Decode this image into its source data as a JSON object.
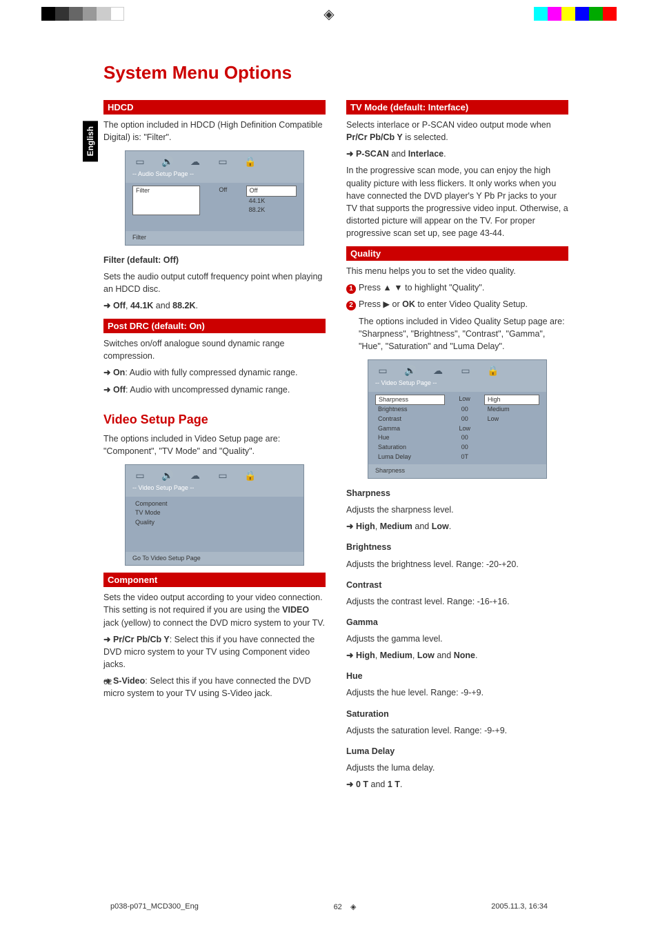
{
  "side_tab": "English",
  "title": "System Menu Options",
  "left": {
    "hdcd": {
      "header": "HDCD",
      "intro": "The option included in HDCD (High Definition Compatible Digital) is: \"Filter\".",
      "ui_crumb": "-- Audio Setup Page --",
      "filter_row": {
        "label": "Filter",
        "value": "Off"
      },
      "options": [
        "Off",
        "44.1K",
        "88.2K"
      ],
      "footer": "Filter",
      "filter_heading": "Filter (default: Off)",
      "filter_body": "Sets the audio output cutoff frequency point when playing an HDCD disc.",
      "filter_opts_prefix": "➜ ",
      "filter_opts": "Off, 44.1K and 88.2K."
    },
    "postdrc": {
      "header": "Post DRC (default: On)",
      "intro": "Switches on/off analogue sound dynamic range compression.",
      "on": "➜ On: Audio with fully compressed dynamic range.",
      "off": "➜ Off: Audio with uncompressed dynamic range."
    },
    "video": {
      "heading": "Video Setup Page",
      "intro": "The options included in Video Setup page are: \"Component\", \"TV Mode\" and \"Quality\".",
      "ui_crumb": "-- Video Setup Page --",
      "items": [
        "Component",
        "TV Mode",
        "Quality"
      ],
      "ui_footer": "Go To Video Setup Page"
    },
    "component": {
      "header": "Component",
      "body1": "Sets the video output according to your video connection. This setting is not required if you are using the VIDEO jack (yellow) to connect the DVD micro system to your TV.",
      "opt1": "➜ Pr/Cr Pb/Cb Y: Select this if you have connected the DVD micro system to your TV using Component video jacks.",
      "opt2": "➜ S-Video: Select this if you have connected the DVD micro system to your TV using S-Video jack."
    }
  },
  "right": {
    "tvmode": {
      "header": "TV Mode (default: Interface)",
      "intro": "Selects interlace or P-SCAN video output mode when Pr/Cr Pb/Cb Y is selected.",
      "opts": "➜ P-SCAN and Interlace.",
      "body": "In the progressive scan mode, you can enjoy the high quality picture with less flickers. It only works when you have connected the DVD player's Y Pb Pr jacks to your TV that supports the progressive video input. Otherwise, a distorted picture will appear on the TV. For proper progressive scan set up, see page 43-44."
    },
    "quality": {
      "header": "Quality",
      "intro": "This menu helps you to set the video quality.",
      "step1": "Press ▲ ▼ to highlight \"Quality\".",
      "step2": "Press ▶ or OK to enter Video Quality Setup.",
      "body": "The options included in Video Quality Setup page are: \"Sharpness\", \"Brightness\", \"Contrast\", \"Gamma\", \"Hue\", \"Saturation\" and \"Luma Delay\".",
      "ui_crumb": "-- Video Setup Page --",
      "table": [
        {
          "name": "Sharpness",
          "val": "Low",
          "opt": "High"
        },
        {
          "name": "Brightness",
          "val": "00",
          "opt": "Medium"
        },
        {
          "name": "Contrast",
          "val": "00",
          "opt": "Low"
        },
        {
          "name": "Gamma",
          "val": "Low",
          "opt": ""
        },
        {
          "name": "Hue",
          "val": "00",
          "opt": ""
        },
        {
          "name": "Saturation",
          "val": "00",
          "opt": ""
        },
        {
          "name": "Luma Delay",
          "val": "0T",
          "opt": ""
        }
      ],
      "ui_footer": "Sharpness"
    },
    "params": {
      "sharpness_h": "Sharpness",
      "sharpness_b": "Adjusts the sharpness level.",
      "sharpness_o": "➜ High, Medium and Low.",
      "brightness_h": "Brightness",
      "brightness_b": "Adjusts the brightness level. Range: -20-+20.",
      "contrast_h": "Contrast",
      "contrast_b": "Adjusts the contrast level. Range: -16-+16.",
      "gamma_h": "Gamma",
      "gamma_b": "Adjusts the gamma level.",
      "gamma_o": "➜ High, Medium, Low and None.",
      "hue_h": "Hue",
      "hue_b": "Adjusts the hue level. Range: -9-+9.",
      "saturation_h": "Saturation",
      "saturation_b": "Adjusts the saturation level. Range: -9-+9.",
      "luma_h": "Luma Delay",
      "luma_b": "Adjusts the luma delay.",
      "luma_o": "➜ 0 T and 1 T."
    }
  },
  "page_num": "62",
  "footer": {
    "file": "p038-p071_MCD300_Eng",
    "page": "62",
    "date": "2005.11.3, 16:34"
  },
  "colors": [
    "#000",
    "#333",
    "#666",
    "#999",
    "#ccc",
    "#fff",
    "#0ff",
    "#f0f",
    "#ff0",
    "#00f",
    "#0a0",
    "#f00"
  ]
}
